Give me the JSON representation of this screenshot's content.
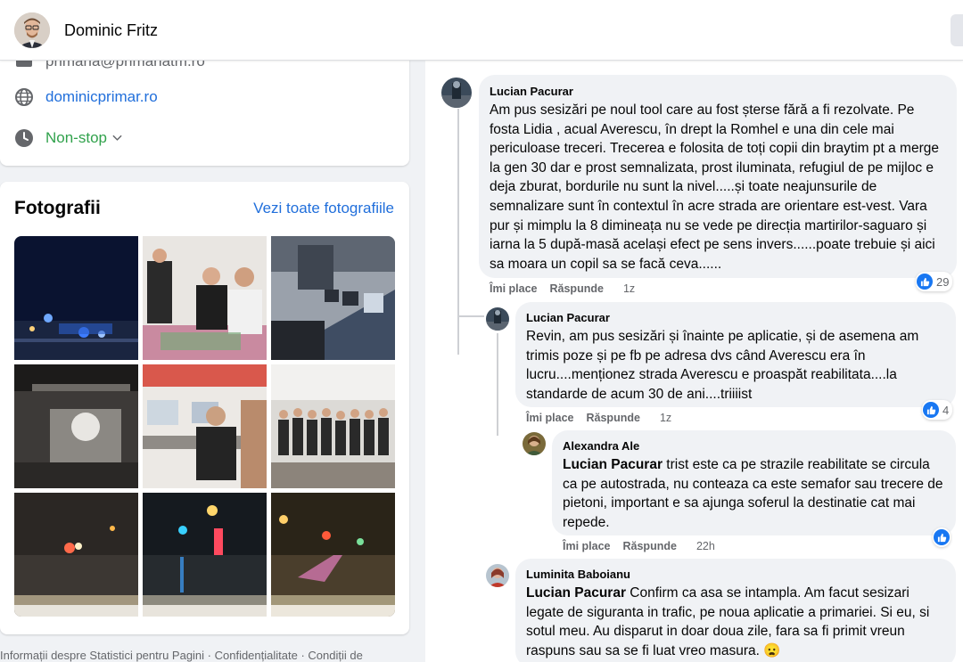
{
  "header": {
    "profile_name": "Dominic Fritz"
  },
  "intro": {
    "email": "primaria@primariatm.ro",
    "website": "dominicprimar.ro",
    "hours": "Non-stop"
  },
  "photos": {
    "title": "Fotografii",
    "see_all": "Vezi toate fotografiile",
    "items": [
      {
        "label": "night-street-police-lights"
      },
      {
        "label": "students-at-table"
      },
      {
        "label": "classroom-computers"
      },
      {
        "label": "3d-printer"
      },
      {
        "label": "kids-at-computers"
      },
      {
        "label": "group-photo"
      },
      {
        "label": "night-drive-rain-1"
      },
      {
        "label": "night-drive-rain-2"
      },
      {
        "label": "night-drive-rain-3"
      }
    ]
  },
  "footer": {
    "links": "Informații despre Statistici pentru Pagini · Confidențialitate · Condiții de"
  },
  "comments": [
    {
      "author": "Lucian Pacurar",
      "text": "Am pus sesizări pe noul tool care au fost șterse fără a fi rezolvate. Pe fosta Lidia , acual Averescu, în drept la Romhel e una din cele mai periculoase treceri. Trecerea e folosita de toți copii din braytim pt a merge la gen 30 dar e prost semnalizata, prost iluminata, refugiul de pe mijloc e deja zburat, bordurile nu sunt la nivel.....și toate neajunsurile de semnalizare sunt în contextul în acre strada are orientare est-vest. Vara pur și mimplu la 8 dimineața nu se vede pe direcția martirilor-saguaro și iarna la 5 după-masă același efect pe sens invers......poate trebuie și aici sa moara un copil sa se facă ceva......",
      "like": "Îmi place",
      "reply": "Răspunde",
      "time": "1z",
      "reactions": "29"
    },
    {
      "author": "Lucian Pacurar",
      "text": "Revin, am pus sesizări și înainte pe aplicatie, și de asemena am trimis poze și pe fb pe adresa dvs când Averescu era în lucru....menționez strada Averescu e proaspăt reabilitata....la standarde de acum 30 de ani....triiiist",
      "like": "Îmi place",
      "reply": "Răspunde",
      "time": "1z",
      "reactions": "4"
    },
    {
      "author": "Alexandra Ale",
      "mention": "Lucian Pacurar",
      "text": " trist este ca pe strazile reabilitate se circula ca pe autostrada, nu conteaza ca este semafor sau trecere de pietoni, important e sa ajunga soferul la destinatie cat mai repede.",
      "like": "Îmi place",
      "reply": "Răspunde",
      "time": "22h"
    },
    {
      "author": "Luminita Baboianu",
      "mention": "Lucian Pacurar",
      "text": " Confirm ca asa se intampla. Am facut sesizari legate de siguranta in trafic, pe noua aplicatie a primariei. Si eu, si sotul meu. Au disparut in doar doua zile, fara sa fi primit vreun raspuns sau sa se fi luat vreo masura. 😦"
    }
  ],
  "colors": {
    "link": "#216fdb",
    "hours_green": "#31a24c",
    "like_blue": "#1877f2",
    "bubble_bg": "#f0f2f5"
  }
}
